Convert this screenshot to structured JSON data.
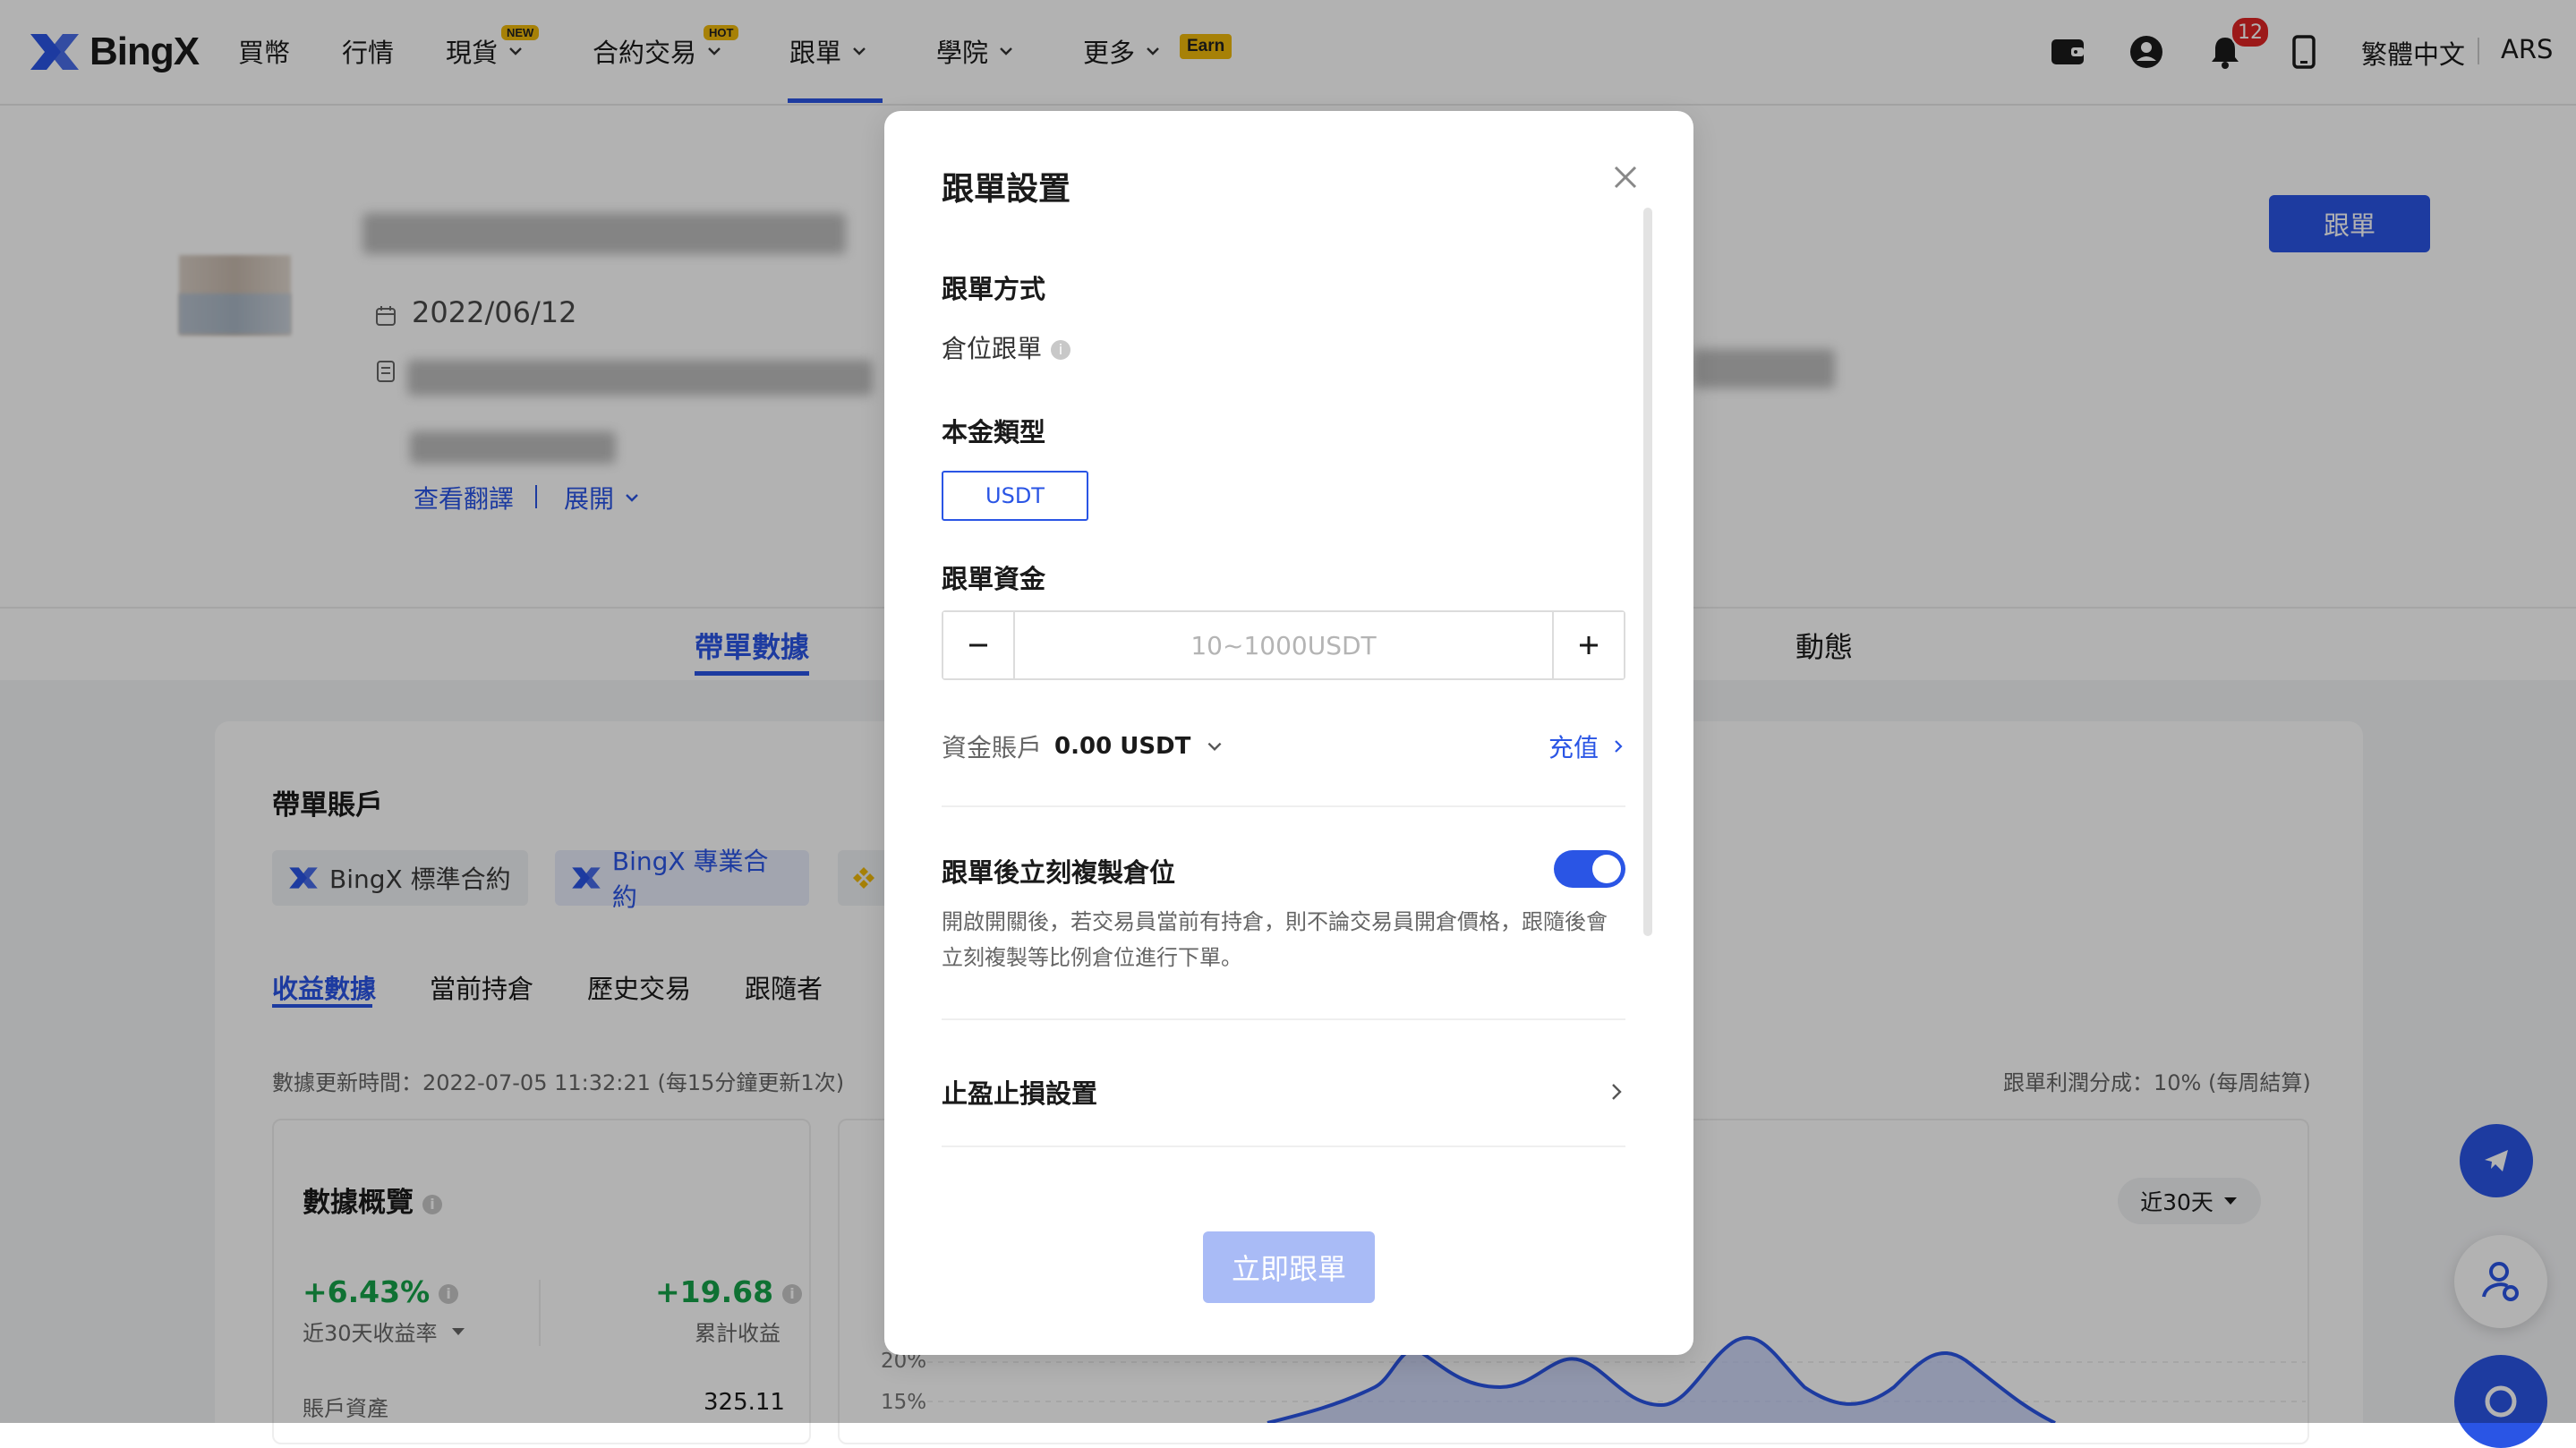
{
  "brand": {
    "name": "BingX",
    "accent": "#2a55e5"
  },
  "nav": {
    "items": [
      {
        "label": "買幣"
      },
      {
        "label": "行情"
      },
      {
        "label": "現貨",
        "tag": "NEW"
      },
      {
        "label": "合約交易",
        "tag": "HOT"
      },
      {
        "label": "跟單"
      },
      {
        "label": "學院"
      },
      {
        "label": "更多",
        "tag": "Earn"
      }
    ],
    "notification_count": "12",
    "language": "繁體中文",
    "currency": "ARS"
  },
  "profile": {
    "join_date": "2022/06/12",
    "translate_link": "查看翻譯",
    "expand_link": "展開",
    "follow_button": "跟單"
  },
  "main_tabs": [
    "帶單數據",
    "動態"
  ],
  "trader_account": {
    "title": "帶單賬戶",
    "accounts": [
      "BingX 標準合約",
      "BingX 專業合約"
    ]
  },
  "sub_tabs": [
    "收益數據",
    "當前持倉",
    "歷史交易",
    "跟隨者"
  ],
  "meta": {
    "update_time": "數據更新時間：2022-07-05 11:32:21 (每15分鐘更新1次)",
    "profit_share": "跟單利潤分成：10% (每周結算)"
  },
  "overview": {
    "title": "數據概覽",
    "roi_value": "+6.43%",
    "roi_label": "近30天收益率",
    "total_profit_value": "+19.68",
    "total_profit_label": "累計收益",
    "assets_label": "賬戶資產",
    "assets_value": "325.11"
  },
  "chart": {
    "range_selector": "近30天",
    "y_ticks": [
      "20%",
      "15%"
    ]
  },
  "modal": {
    "title": "跟單設置",
    "mode_label": "跟單方式",
    "mode_value": "倉位跟單",
    "principal_label": "本金類型",
    "principal_option": "USDT",
    "funds_label": "跟單資金",
    "funds_placeholder": "10~1000USDT",
    "account_label": "資金賬戶",
    "account_balance": "0.00 USDT",
    "deposit_link": "充值",
    "copy_toggle_label": "跟單後立刻複製倉位",
    "copy_toggle_on": true,
    "copy_toggle_desc": "開啟開關後，若交易員當前有持倉，則不論交易員開倉價格，跟隨後會立刻複製等比例倉位進行下單。",
    "tp_sl_label": "止盈止損設置",
    "submit_button": "立即跟單"
  }
}
